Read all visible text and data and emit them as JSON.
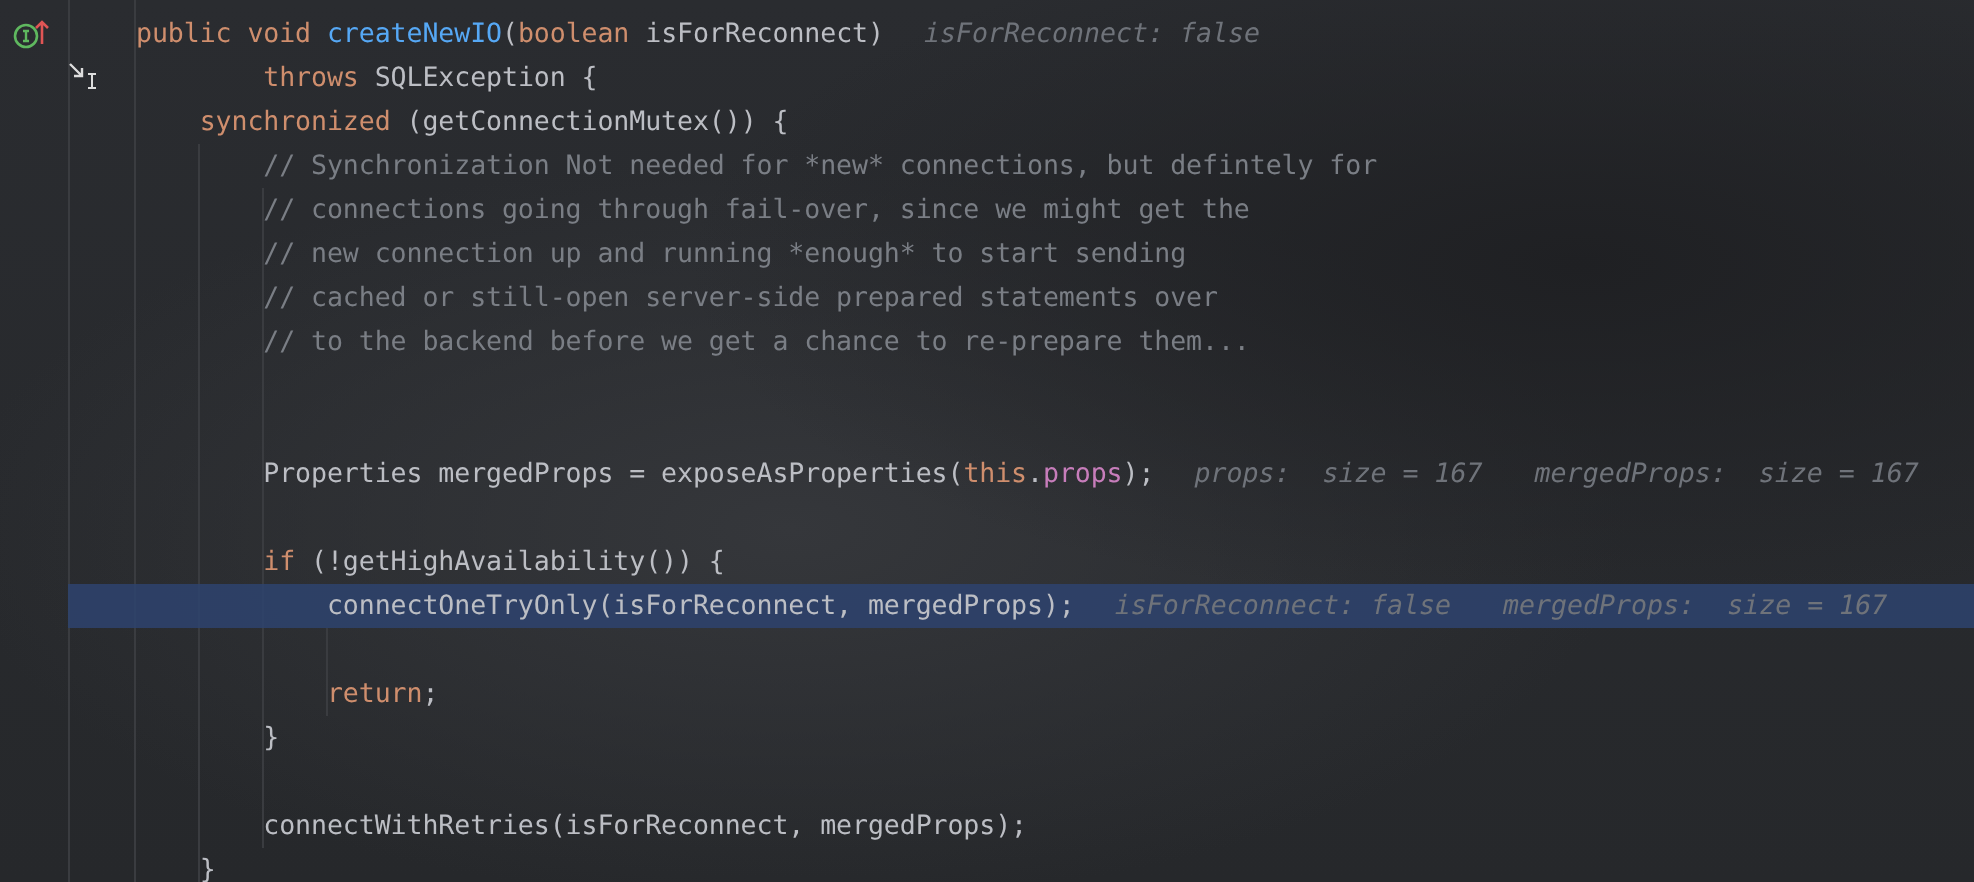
{
  "editor": {
    "lines": [
      {
        "selected": false,
        "tokens": [
          {
            "text": "public void ",
            "kind": "keyword"
          },
          {
            "text": "createNewIO",
            "kind": "decl"
          },
          {
            "text": "(",
            "kind": "plain"
          },
          {
            "text": "boolean ",
            "kind": "keyword"
          },
          {
            "text": "isForReconnect)",
            "kind": "plain"
          }
        ],
        "hints": [
          "isForReconnect: false"
        ]
      },
      {
        "selected": false,
        "tokens": [
          {
            "text": "        throws ",
            "kind": "keyword"
          },
          {
            "text": "SQLException {",
            "kind": "plain"
          }
        ]
      },
      {
        "selected": false,
        "tokens": [
          {
            "text": "    synchronized ",
            "kind": "keyword"
          },
          {
            "text": "(getConnectionMutex()) {",
            "kind": "plain"
          }
        ]
      },
      {
        "selected": false,
        "tokens": [
          {
            "text": "        // Synchronization Not needed for *new* connections, but defintely for",
            "kind": "comment"
          }
        ]
      },
      {
        "selected": false,
        "tokens": [
          {
            "text": "        // connections going through fail-over, since we might get the",
            "kind": "comment"
          }
        ]
      },
      {
        "selected": false,
        "tokens": [
          {
            "text": "        // new connection up and running *enough* to start sending",
            "kind": "comment"
          }
        ]
      },
      {
        "selected": false,
        "tokens": [
          {
            "text": "        // cached or still-open server-side prepared statements over",
            "kind": "comment"
          }
        ]
      },
      {
        "selected": false,
        "tokens": [
          {
            "text": "        // to the backend before we get a chance to re-prepare them...",
            "kind": "comment"
          }
        ]
      },
      {
        "selected": false
      },
      {
        "selected": false
      },
      {
        "selected": false,
        "tokens": [
          {
            "text": "        Properties mergedProps = exposeAsProperties(",
            "kind": "plain"
          },
          {
            "text": "this",
            "kind": "keyword"
          },
          {
            "text": ".",
            "kind": "plain"
          },
          {
            "text": "props",
            "kind": "field"
          },
          {
            "text": ");",
            "kind": "plain"
          }
        ],
        "hints": [
          "props:  size = 167",
          "mergedProps:  size = 167"
        ]
      },
      {
        "selected": false
      },
      {
        "selected": false,
        "tokens": [
          {
            "text": "        if ",
            "kind": "keyword"
          },
          {
            "text": "(!getHighAvailability()) {",
            "kind": "plain"
          }
        ]
      },
      {
        "selected": true,
        "tokens": [
          {
            "text": "            connectOneTryOnly(isForReconnect, mergedProps);",
            "kind": "plain"
          }
        ],
        "hints": [
          "isForReconnect: false",
          "mergedProps:  size = 167"
        ]
      },
      {
        "selected": false
      },
      {
        "selected": false,
        "tokens": [
          {
            "text": "            return",
            "kind": "keyword"
          },
          {
            "text": ";",
            "kind": "plain"
          }
        ]
      },
      {
        "selected": false,
        "tokens": [
          {
            "text": "        }",
            "kind": "plain"
          }
        ]
      },
      {
        "selected": false
      },
      {
        "selected": false,
        "tokens": [
          {
            "text": "        connectWithRetries(isForReconnect, mergedProps);",
            "kind": "plain"
          }
        ]
      },
      {
        "selected": false,
        "tokens": [
          {
            "text": "    }",
            "kind": "plain"
          }
        ]
      }
    ]
  }
}
